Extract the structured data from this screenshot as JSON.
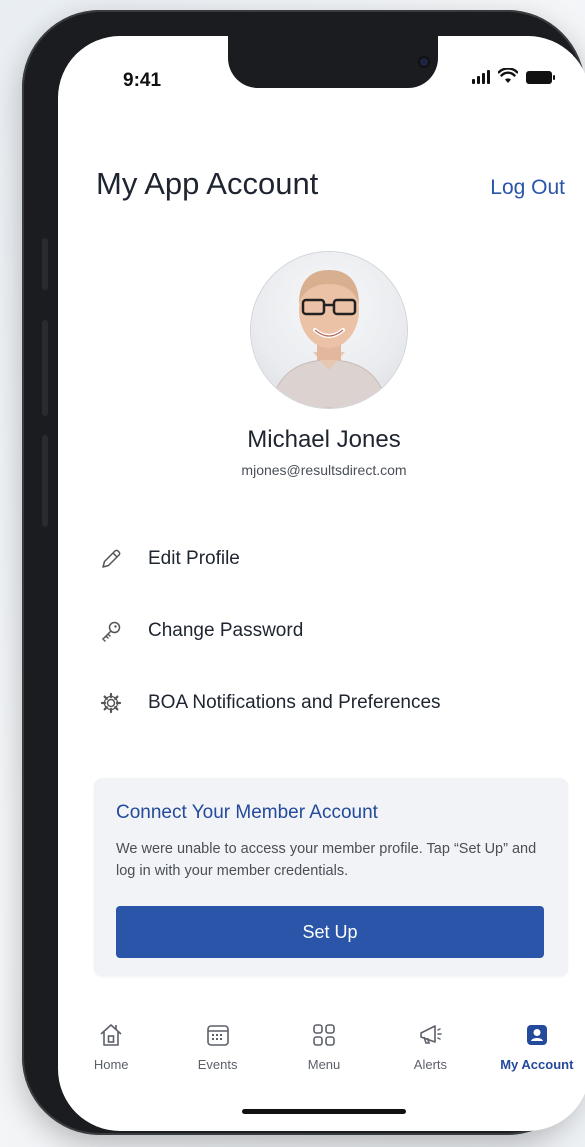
{
  "status_bar": {
    "time": "9:41"
  },
  "header": {
    "title": "My App Account",
    "logout_label": "Log Out"
  },
  "profile": {
    "name": "Michael Jones",
    "email": "mjones@resultsdirect.com",
    "avatar_alt": "profile photo"
  },
  "menu": [
    {
      "label": "Edit Profile",
      "icon": "pencil-icon"
    },
    {
      "label": "Change Password",
      "icon": "key-icon"
    },
    {
      "label": "BOA Notifications and Preferences",
      "icon": "gear-icon"
    }
  ],
  "member_card": {
    "title": "Connect Your Member Account",
    "text": "We were unable to access your member profile. Tap “Set Up” and log in with your member credentials.",
    "button_label": "Set Up"
  },
  "tabbar": {
    "tabs": [
      {
        "label": "Home",
        "icon": "home-icon"
      },
      {
        "label": "Events",
        "icon": "calendar-icon"
      },
      {
        "label": "Menu",
        "icon": "grid-icon"
      },
      {
        "label": "Alerts",
        "icon": "megaphone-icon"
      },
      {
        "label": "My Account",
        "icon": "account-icon"
      }
    ],
    "active": "My Account"
  },
  "colors": {
    "accent": "#2a55a8",
    "card_title": "#234a9b",
    "card_bg": "#f1f3f6"
  }
}
